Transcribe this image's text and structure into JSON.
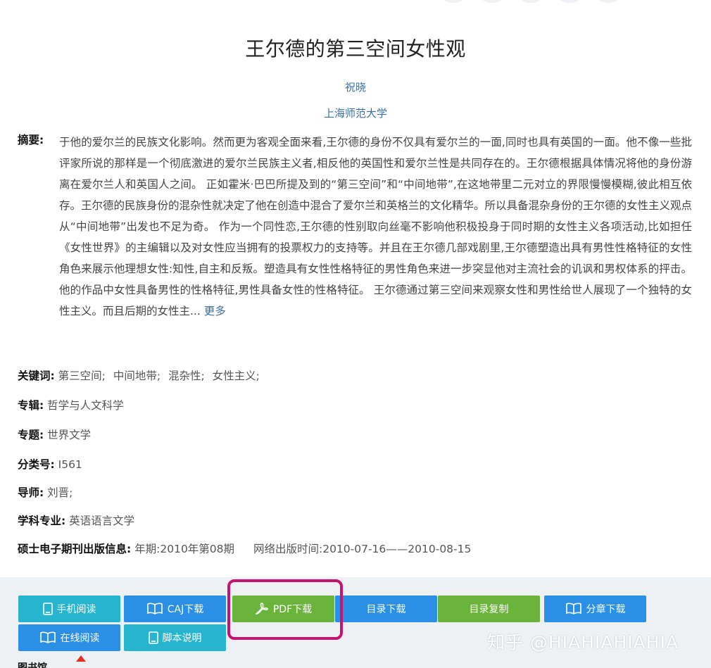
{
  "paper": {
    "title": "王尔德的第三空间女性观",
    "author": "祝晓",
    "organization": "上海师范大学"
  },
  "abstract": {
    "label": "摘要:",
    "text": "于他的爱尔兰的民族文化影响。然而更为客观全面来看,王尔德的身份不仅具有爱尔兰的一面,同时也具有英国的一面。他不像一些批评家所说的那样是一个彻底激进的爱尔兰民族主义者,相反他的英国性和爱尔兰性是共同存在的。王尔德根据具体情况将他的身份游离在爱尔兰人和英国人之间。 正如霍米·巴巴所提及到的“第三空间”和“中间地带”,在这地带里二元对立的界限慢慢模糊,彼此相互依存。王尔德的民族身份的混杂性就决定了他在创造中混合了爱尔兰和英格兰的文化精华。所以具备混杂身份的王尔德的女性主义观点从“中间地带”出发也不足为奇。 作为一个同性恋,王尔德的性别取向丝毫不影响他积极投身于同时期的女性主义各项活动,比如担任《女性世界》的主编辑以及对女性应当拥有的投票权力的支持等。并且在王尔德几部戏剧里,王尔德塑造出具有男性性格特征的女性角色来展示他理想女性:知性,自主和反叛。塑造具有女性性格特征的男性角色来进一步突显他对主流社会的讥讽和男权体系的抨击。他的作品中女性具备男性的性格特征,男性具备女性的性格特征。 王尔德通过第三空间来观察女性和男性给世人展现了一个独特的女性主义。而且后期的女性主...",
    "more": "更多"
  },
  "meta": {
    "keywords_label": "关键词:",
    "keywords": [
      "第三空间;",
      "中间地带;",
      "混杂性;",
      "女性主义;"
    ],
    "series_label": "专辑:",
    "series": "哲学与人文科学",
    "topic_label": "专题:",
    "topic": "世界文学",
    "class_label": "分类号:",
    "class": "I561",
    "advisor_label": "导师:",
    "advisor": "刘晋;",
    "major_label": "学科专业:",
    "major": "英语语言文学",
    "pub_label": "硕士电子期刊出版信息:",
    "pub_issue": "年期:2010年第08期",
    "pub_online": "网络出版时间:2010-07-16——2010-08-15"
  },
  "actions": {
    "mobile_read": "手机阅读",
    "caj_download": "CAJ下载",
    "pdf_download": "PDF下载",
    "toc_download": "目录下载",
    "toc_copy": "目录复制",
    "chapter_download": "分章下载",
    "online_read": "在线阅读",
    "script_note": "脚本说明"
  },
  "watermark": "知乎 @HIAHIAHIAHIA",
  "bottom_label": "图书馆",
  "colors": {
    "teal": "#27b4cf",
    "blue": "#2b8fe6",
    "green": "#6bb43c",
    "highlight": "#c8126f",
    "link": "#3a6fa8"
  }
}
